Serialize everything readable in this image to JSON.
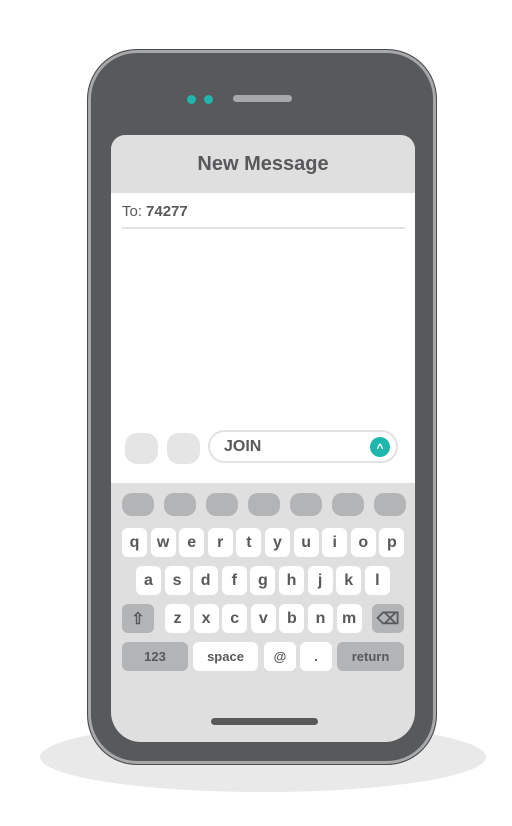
{
  "header": {
    "title": "New Message"
  },
  "recipient": {
    "label": "To:",
    "value": "74277"
  },
  "composer": {
    "message": "JOIN",
    "send_icon": "chevron-up-icon",
    "accent_color": "#1fb6ae"
  },
  "keyboard": {
    "row1": [
      "q",
      "w",
      "e",
      "r",
      "t",
      "y",
      "u",
      "i",
      "o",
      "p"
    ],
    "row2": [
      "a",
      "s",
      "d",
      "f",
      "g",
      "h",
      "j",
      "k",
      "l"
    ],
    "row3": [
      "z",
      "x",
      "c",
      "v",
      "b",
      "n",
      "m"
    ],
    "shift_icon": "shift-arrow-icon",
    "backspace_icon": "backspace-icon",
    "numbers_label": "123",
    "space_label": "space",
    "at_label": "@",
    "period_label": ".",
    "return_label": "return"
  }
}
